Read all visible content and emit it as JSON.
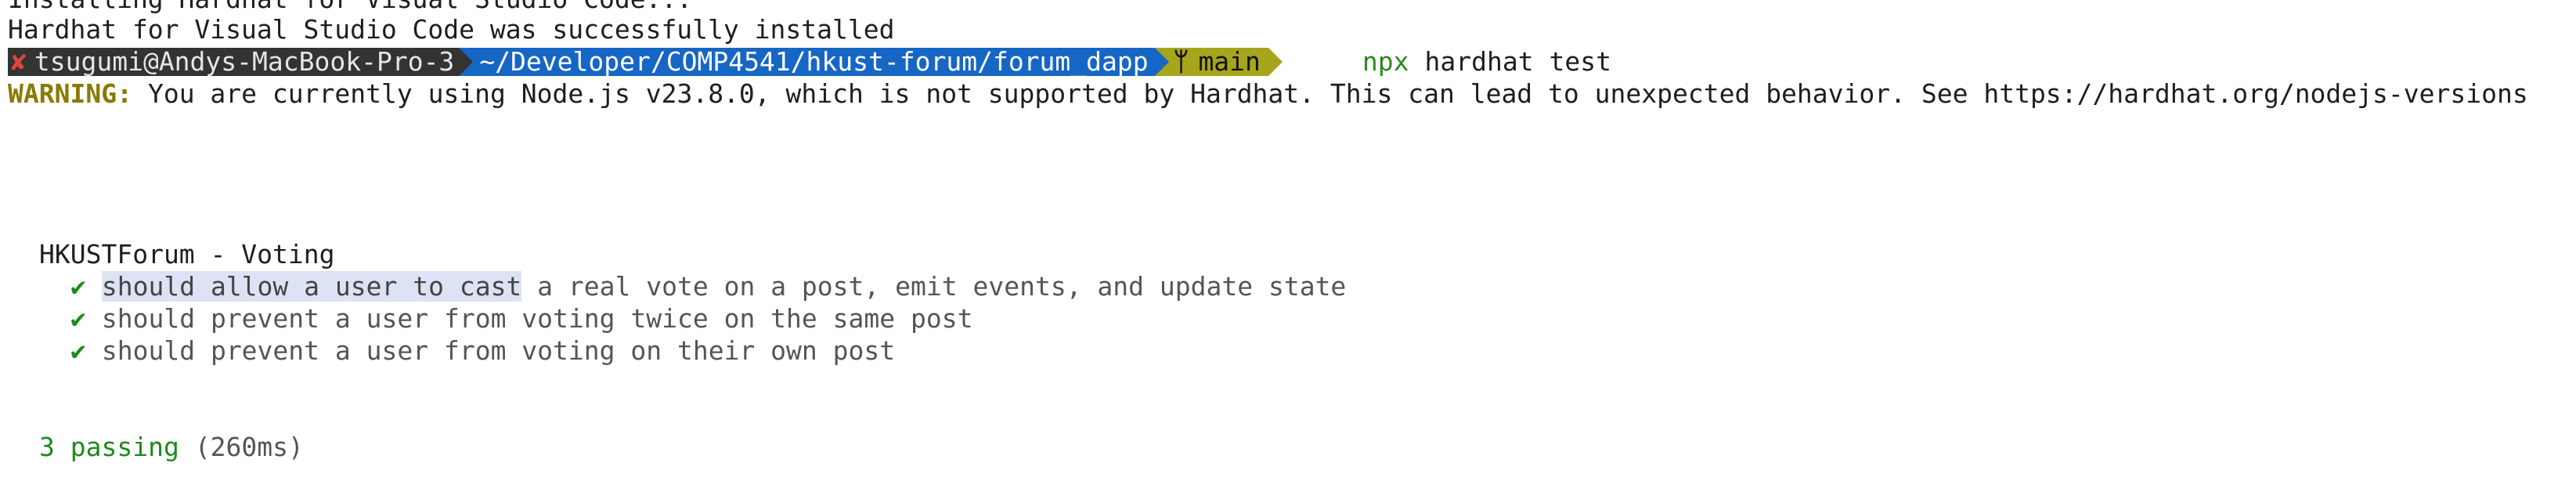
{
  "output": {
    "line_installing": "Installing Hardhat for Visual Studio Code...",
    "line_installed": "Hardhat for Visual Studio Code was successfully installed"
  },
  "prompt": {
    "status_icon": "✘",
    "user_host": "tsugumi@Andys-MacBook-Pro-3",
    "path": "~/Developer/COMP4541/hkust-forum/forum_dapp",
    "branch_icon": "branch-icon",
    "branch_glyph": "ᛘ",
    "branch": "main",
    "command_bin": "npx",
    "command_args": "hardhat test",
    "colors": {
      "user_bg": "#333333",
      "path_bg": "#1666c5",
      "git_bg": "#a7a51b",
      "error": "#e0443e"
    }
  },
  "warning": {
    "label": "WARNING:",
    "message": "You are currently using Node.js v23.8.0, which is not supported by Hardhat. This can lead to unexpected behavior. See https://hardhat.org/nodejs-versions"
  },
  "suite": {
    "title": "HKUSTForum - Voting",
    "tests": [
      {
        "check": "✔",
        "text_selected": "should allow a user to cast",
        "text": " a real vote on a post, emit events, and update state"
      },
      {
        "check": "✔",
        "text": "should prevent a user from voting twice on the same post"
      },
      {
        "check": "✔",
        "text": "should prevent a user from voting on their own post"
      }
    ]
  },
  "summary": {
    "passing": "3 passing",
    "duration": "(260ms)"
  }
}
